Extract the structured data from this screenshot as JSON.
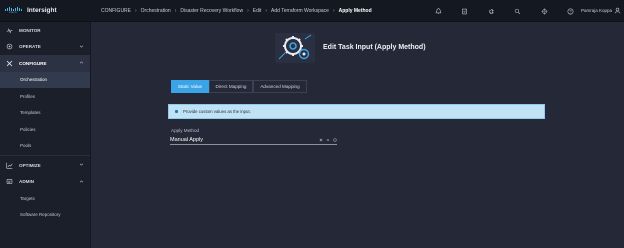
{
  "brand": {
    "logo_text": "cisco",
    "app_name": "Intersight"
  },
  "breadcrumb": [
    "CONFIGURE",
    "Orchestration",
    "Disaster Recovery Workflow",
    "Edit",
    "Add Terraform Workspace",
    "Apply Method"
  ],
  "header": {
    "icons": [
      "bell-icon",
      "task-icon",
      "announcement-icon",
      "search-icon",
      "gear-icon",
      "help-icon"
    ],
    "user_name": "Pamraja Koppa"
  },
  "sidebar": {
    "monitor": "MONITOR",
    "operate": "OPERATE",
    "configure": "CONFIGURE",
    "configure_items": [
      "Orchestration",
      "Profiles",
      "Templates",
      "Policies",
      "Pools"
    ],
    "optimize": "OPTIMIZE",
    "admin": "ADMIN",
    "admin_items": [
      "Targets",
      "Software Repository"
    ]
  },
  "page": {
    "title": "Edit Task Input (Apply Method)",
    "tabs": [
      "Static Value",
      "Direct Mapping",
      "Advanced Mapping"
    ],
    "info": "Provide custom values as the input.",
    "field_label": "Apply Method",
    "field_value": "Manual Apply"
  },
  "colors": {
    "accent": "#3ba4e6",
    "banner": "#bfe3f5",
    "background": "#242837",
    "sidebar": "#1b1f2a"
  }
}
